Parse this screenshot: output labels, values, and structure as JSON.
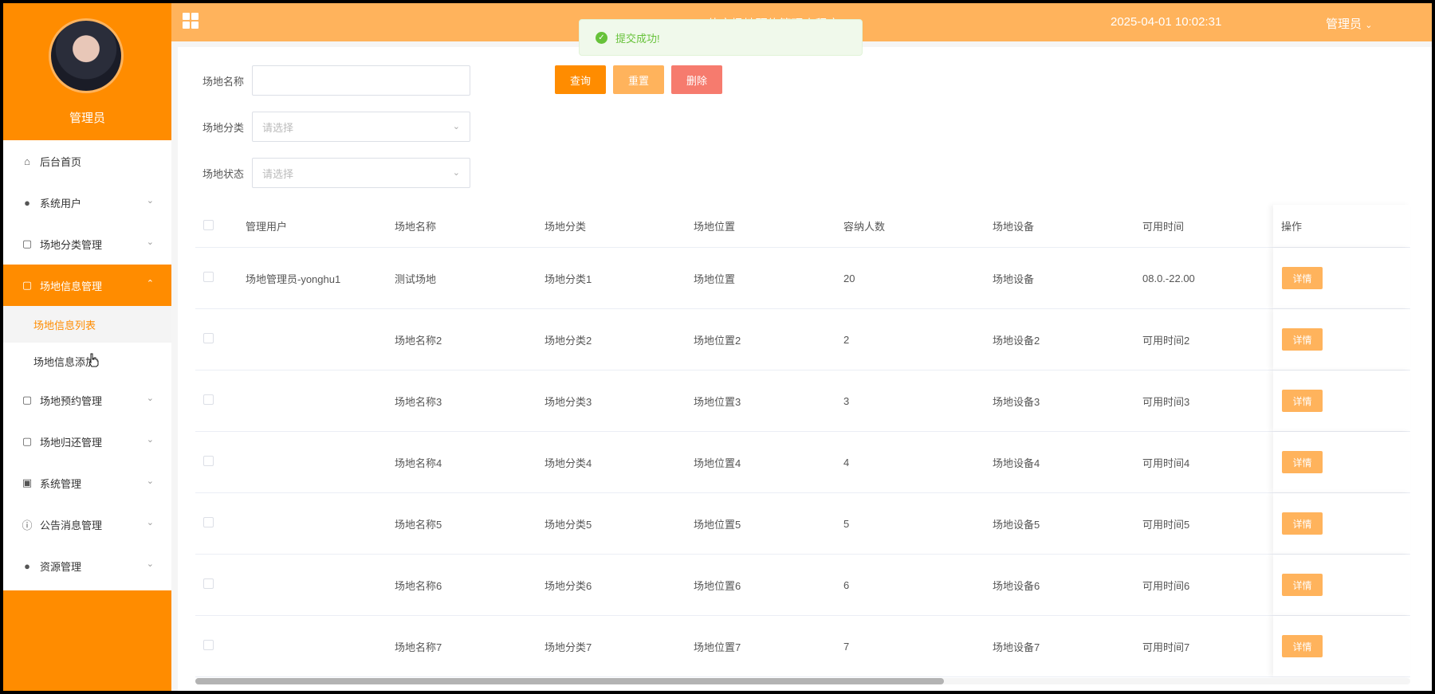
{
  "header": {
    "title": "...体育场地预约管理小程序",
    "datetime": "2025-04-01 10:02:31",
    "user_label": "管理员",
    "user_caret": "⌄",
    "bg_color": "#ffb35c"
  },
  "toast": {
    "icon": "✓",
    "message": "提交成功!",
    "color": "#67c23a"
  },
  "sidebar": {
    "profile_name": "管理员",
    "accent_color": "#ff8c00",
    "items": [
      {
        "label": "后台首页",
        "icon": "home-icon",
        "glyph": "⌂",
        "chevron": ""
      },
      {
        "label": "系统用户",
        "icon": "user-icon",
        "glyph": "●",
        "chevron": "⌄"
      },
      {
        "label": "场地分类管理",
        "icon": "folder-icon",
        "glyph": "▢",
        "chevron": "⌄"
      },
      {
        "label": "场地信息管理",
        "icon": "folder-icon",
        "glyph": "▢",
        "chevron": "⌃"
      },
      {
        "label": "场地预约管理",
        "icon": "folder-icon",
        "glyph": "▢",
        "chevron": "⌄"
      },
      {
        "label": "场地归还管理",
        "icon": "folder-icon",
        "glyph": "▢",
        "chevron": "⌄"
      },
      {
        "label": "系统管理",
        "icon": "image-icon",
        "glyph": "▣",
        "chevron": "⌄"
      },
      {
        "label": "公告消息管理",
        "icon": "info-icon",
        "glyph": "ⓘ",
        "chevron": "⌄"
      },
      {
        "label": "资源管理",
        "icon": "location-icon",
        "glyph": "●",
        "chevron": "⌄"
      }
    ],
    "submenu": [
      {
        "label": "场地信息列表"
      },
      {
        "label": "场地信息添加"
      }
    ]
  },
  "filters": {
    "name_label": "场地名称",
    "name_value": "",
    "category_label": "场地分类",
    "category_placeholder": "请选择",
    "status_label": "场地状态",
    "status_placeholder": "请选择",
    "select_arrow": "⌄"
  },
  "buttons": {
    "query": "查询",
    "reset": "重置",
    "delete": "删除"
  },
  "table": {
    "columns": [
      "管理用户",
      "场地名称",
      "场地分类",
      "场地位置",
      "容纳人数",
      "场地设备",
      "可用时间",
      "操作"
    ],
    "detail_label": "详情",
    "rows": [
      {
        "user": "场地管理员-yonghu1",
        "name": "测试场地",
        "category": "场地分类1",
        "location": "场地位置",
        "capacity": "20",
        "device": "场地设备",
        "time": "08.0.-22.00"
      },
      {
        "user": "",
        "name": "场地名称2",
        "category": "场地分类2",
        "location": "场地位置2",
        "capacity": "2",
        "device": "场地设备2",
        "time": "可用时间2"
      },
      {
        "user": "",
        "name": "场地名称3",
        "category": "场地分类3",
        "location": "场地位置3",
        "capacity": "3",
        "device": "场地设备3",
        "time": "可用时间3"
      },
      {
        "user": "",
        "name": "场地名称4",
        "category": "场地分类4",
        "location": "场地位置4",
        "capacity": "4",
        "device": "场地设备4",
        "time": "可用时间4"
      },
      {
        "user": "",
        "name": "场地名称5",
        "category": "场地分类5",
        "location": "场地位置5",
        "capacity": "5",
        "device": "场地设备5",
        "time": "可用时间5"
      },
      {
        "user": "",
        "name": "场地名称6",
        "category": "场地分类6",
        "location": "场地位置6",
        "capacity": "6",
        "device": "场地设备6",
        "time": "可用时间6"
      },
      {
        "user": "",
        "name": "场地名称7",
        "category": "场地分类7",
        "location": "场地位置7",
        "capacity": "7",
        "device": "场地设备7",
        "time": "可用时间7"
      }
    ]
  }
}
